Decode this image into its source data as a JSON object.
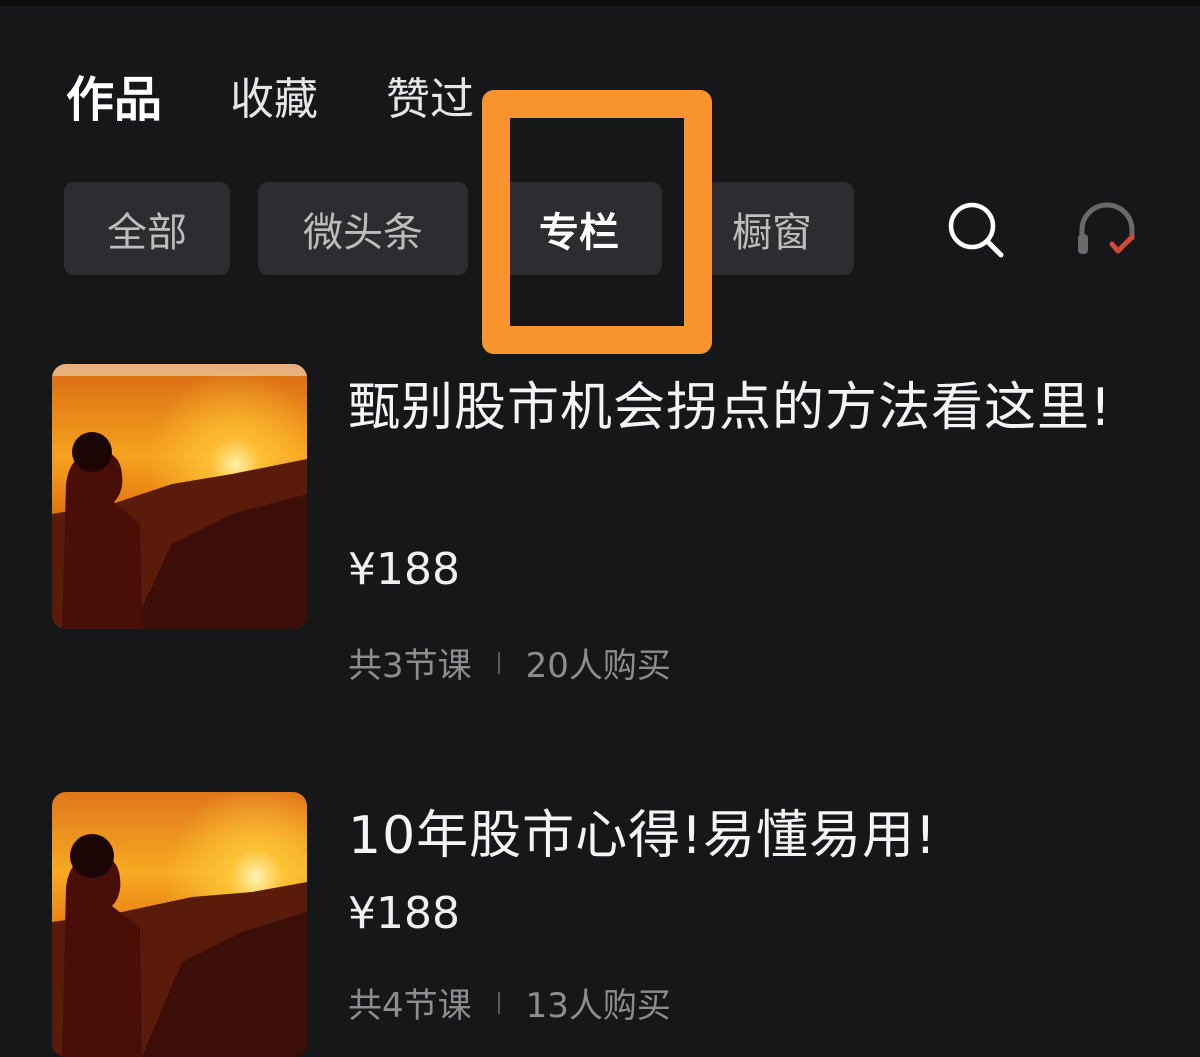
{
  "main_tabs": [
    {
      "label": "作品",
      "active": true
    },
    {
      "label": "收藏",
      "active": false
    },
    {
      "label": "赞过",
      "active": false
    }
  ],
  "sub_tabs": [
    {
      "label": "全部",
      "active": false
    },
    {
      "label": "微头条",
      "active": false
    },
    {
      "label": "专栏",
      "active": true
    },
    {
      "label": "橱窗",
      "active": false
    }
  ],
  "toolbar": {
    "search_icon": "search-icon",
    "support_icon": "headset-icon"
  },
  "colors": {
    "background": "#161719",
    "tab_bg": "#2c2d31",
    "highlight": "#f7942e",
    "meta_text": "#8d8d8d"
  },
  "items": [
    {
      "title": "甄别股市机会拐点的方法看这里!",
      "price": "¥188",
      "lessons": "共3节课",
      "buyers": "20人购买"
    },
    {
      "title": "10年股市心得!易懂易用!",
      "price": "¥188",
      "lessons": "共4节课",
      "buyers": "13人购买"
    }
  ]
}
